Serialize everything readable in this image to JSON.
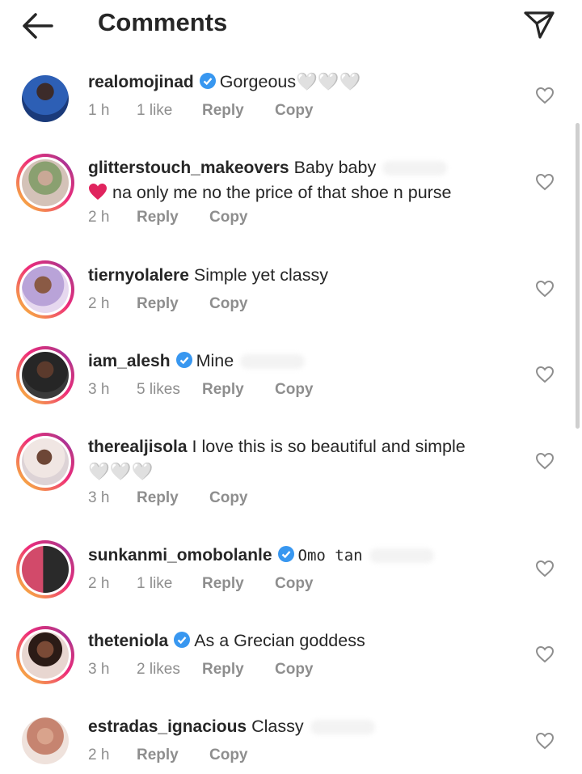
{
  "header": {
    "title": "Comments"
  },
  "icons": {
    "back": "arrow-left-icon",
    "send": "paper-plane-icon",
    "like": "heart-outline-icon",
    "verified": "verified-badge-icon"
  },
  "colors": {
    "verified": "#3897f0",
    "muted": "#8e8e8e",
    "text": "#262626",
    "red_heart": "#e0245e"
  },
  "comments": [
    {
      "username": "realomojinad",
      "verified": true,
      "text": "Gorgeous",
      "emoji": "🤍🤍🤍",
      "time": "1 h",
      "likes": "1 like",
      "reply": "Reply",
      "copy": "Copy"
    },
    {
      "username": "glitterstouch_makeovers",
      "verified": false,
      "text": "Baby baby",
      "line2_emoji": "❤️",
      "line2": "na only me no the price of that shoe n purse",
      "time": "2 h",
      "likes": "",
      "reply": "Reply",
      "copy": "Copy"
    },
    {
      "username": "tiernyolalere",
      "verified": false,
      "text": "Simple yet classy",
      "time": "2 h",
      "likes": "",
      "reply": "Reply",
      "copy": "Copy"
    },
    {
      "username": "iam_alesh",
      "verified": true,
      "text": "Mine",
      "time": "3 h",
      "likes": "5 likes",
      "reply": "Reply",
      "copy": "Copy"
    },
    {
      "username": "therealjisola",
      "verified": false,
      "text": "I love this is so beautiful and simple",
      "emoji": "🤍🤍🤍",
      "time": "3 h",
      "likes": "",
      "reply": "Reply",
      "copy": "Copy"
    },
    {
      "username": "sunkanmi_omobolanle",
      "verified": true,
      "text": "Omo tan",
      "time": "2 h",
      "likes": "1 like",
      "reply": "Reply",
      "copy": "Copy"
    },
    {
      "username": "theteniola",
      "verified": true,
      "text": "As a Grecian goddess",
      "time": "3 h",
      "likes": "2 likes",
      "reply": "Reply",
      "copy": "Copy"
    },
    {
      "username": "estradas_ignacious",
      "verified": false,
      "text": "Classy",
      "time": "2 h",
      "likes": "",
      "reply": "Reply",
      "copy": "Copy"
    }
  ]
}
